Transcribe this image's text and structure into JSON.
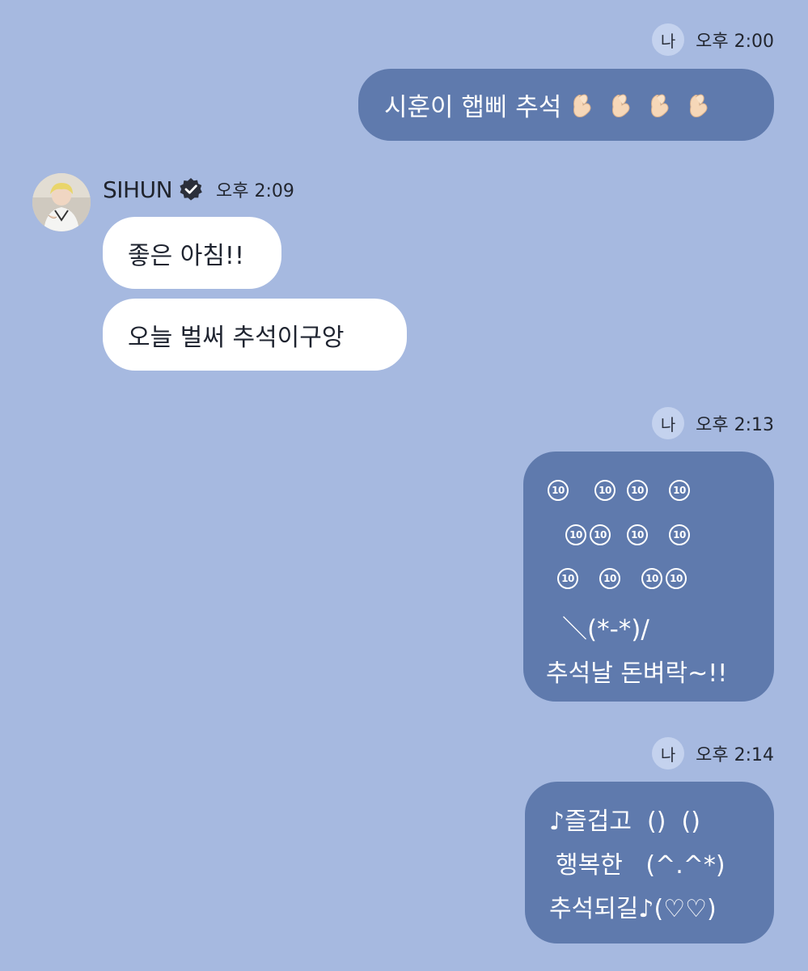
{
  "messages": [
    {
      "sender": "me",
      "badge": "나",
      "time": "오후 2:00",
      "text": "시훈이 햅삐 추석",
      "emoji": [
        "finger-heart",
        "finger-heart",
        "finger-heart",
        "finger-heart"
      ]
    },
    {
      "sender": "artist",
      "name": "SIHUN",
      "verified": true,
      "time": "오후 2:09",
      "bubbles": [
        "좋은 아침!!",
        "오늘 벌써 추석이구앙"
      ]
    },
    {
      "sender": "me",
      "badge": "나",
      "time": "오후 2:13",
      "ascii_rows": [
        [
          "⑩",
          "⑩",
          "⑩",
          "⑩"
        ],
        [
          "⑩",
          "⑩",
          "⑩",
          "⑩"
        ],
        [
          "⑩",
          "⑩",
          "⑩",
          "⑩"
        ]
      ],
      "ten_label": "10",
      "lines": [
        "＼(*-*)/",
        "추석날 돈벼락~!!"
      ]
    },
    {
      "sender": "me",
      "badge": "나",
      "time": "오후 2:14",
      "lines": [
        "♪즐겁고  ()  ()",
        "행복한   (^.^*)",
        "추석되길♪(♡♡)"
      ]
    }
  ],
  "colors": {
    "background": "#a6b9e0",
    "my_bubble": "#5f7aad",
    "artist_bubble": "#ffffff",
    "verified_badge": "#2b2f3a"
  }
}
